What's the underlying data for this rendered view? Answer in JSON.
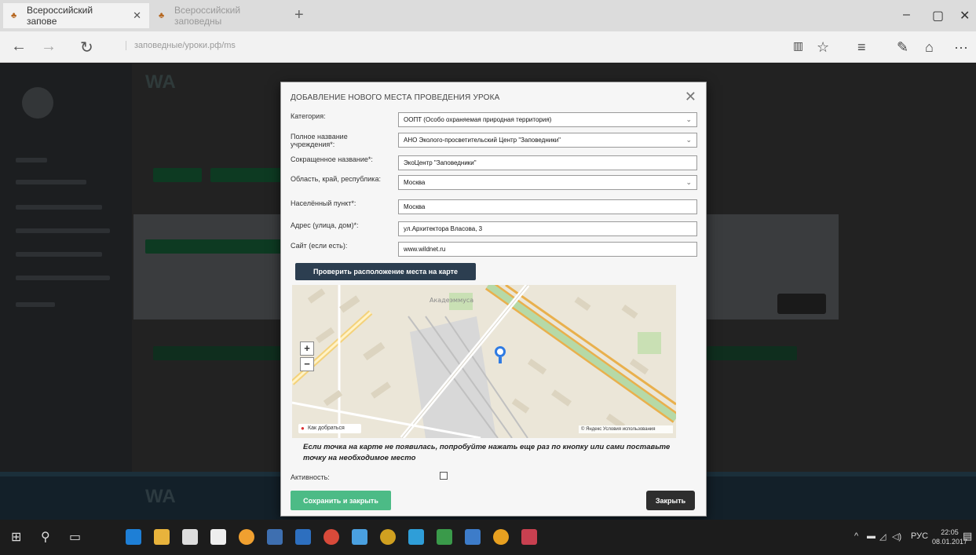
{
  "browser": {
    "tabs": [
      {
        "title": "Всероссийский заповe"
      },
      {
        "title": "Всероссийский заповедны"
      }
    ],
    "url": "заповедные/уроки.рф/ms",
    "icons": {
      "back": "←",
      "forward": "→",
      "refresh": "↻",
      "star": "☆",
      "hub": "≡",
      "notes": "✎",
      "share": "⌂",
      "more": "···"
    }
  },
  "modal": {
    "title": "ДОБАВЛЕНИЕ НОВОГО МЕСТА ПРОВЕДЕНИЯ УРОКА",
    "fields": [
      {
        "label": "Категория:",
        "value": "ООПТ (Особо охраняемая природная территория)"
      },
      {
        "label": "Полное название учреждения*:",
        "value": "АНО Эколого-просветительский Центр \"Заповедники\""
      },
      {
        "label": "Сокращенное название*:",
        "value": "ЭкоЦентр \"Заповедники\""
      },
      {
        "label": "Область, край, республика:",
        "value": "Москва"
      },
      {
        "label": "Населённый пункт*:",
        "value": "Москва"
      },
      {
        "label": "Адрес (улица, дом)*:",
        "value": "ул.Архитектора Власова, 3"
      },
      {
        "label": "Сайт (если есть):",
        "value": "www.wildnet.ru"
      }
    ],
    "check_button": "Проверить расположение места на карте",
    "map": {
      "zoom_in": "+",
      "zoom_out": "−",
      "footer_label": "Как добраться",
      "copyright": "© Яндекс Условия использования",
      "district_label": "Акадеэммуса"
    },
    "hint": "Если точка на карте не появилась, попробуйте нажать еще раз по кнопку или сами поставьте точку на необходимое место",
    "activity_label": "Активность:",
    "save_button": "Сохранить и закрыть",
    "close_button": "Закрыть"
  },
  "taskbar": {
    "language": "РУС",
    "time": "22:05",
    "date": "08.01.2017"
  }
}
